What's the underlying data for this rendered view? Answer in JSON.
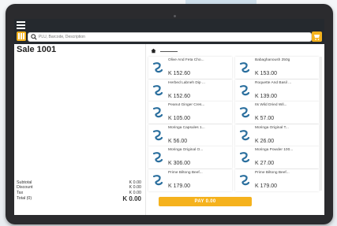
{
  "sale": {
    "title": "Sale 1001"
  },
  "search": {
    "placeholder": "PLU, Barcode, Description"
  },
  "totals": [
    {
      "label": "Subtotal",
      "value": "K 0.00"
    },
    {
      "label": "Discount",
      "value": "K 0.00"
    },
    {
      "label": "Tax",
      "value": "K 0.00"
    },
    {
      "label": "Total (0)",
      "value": "K 0.00"
    }
  ],
  "products": [
    {
      "name": "Olive And Feta Cho...",
      "price": "K 152.60"
    },
    {
      "name": "Babaghanoush 250g",
      "price": "K 153.00"
    },
    {
      "name": "Herbed Labneh Dip ...",
      "price": "K 152.60"
    },
    {
      "name": "Roquette And Basil ...",
      "price": "K 139.00"
    },
    {
      "name": "Peanut Ginger Cres...",
      "price": "K 105.00"
    },
    {
      "name": "Its Wild Dried Wil...",
      "price": "K 57.00"
    },
    {
      "name": "Moringa Capsules 1...",
      "price": "K 56.00"
    },
    {
      "name": "Moringa Original T...",
      "price": "K 26.00"
    },
    {
      "name": "Moringa Original O...",
      "price": "K 306.00"
    },
    {
      "name": "Moringa Powder 100...",
      "price": "K 27.00"
    },
    {
      "name": "Prime Biltong Beef...",
      "price": "K 179.00"
    },
    {
      "name": "Prime Biltong Beef...",
      "price": "K 179.00"
    }
  ],
  "pay": {
    "label": "PAY 0.00"
  },
  "colors": {
    "accent": "#f5b21d",
    "appbar": "#25292e",
    "logo": "#2b6f9e"
  }
}
